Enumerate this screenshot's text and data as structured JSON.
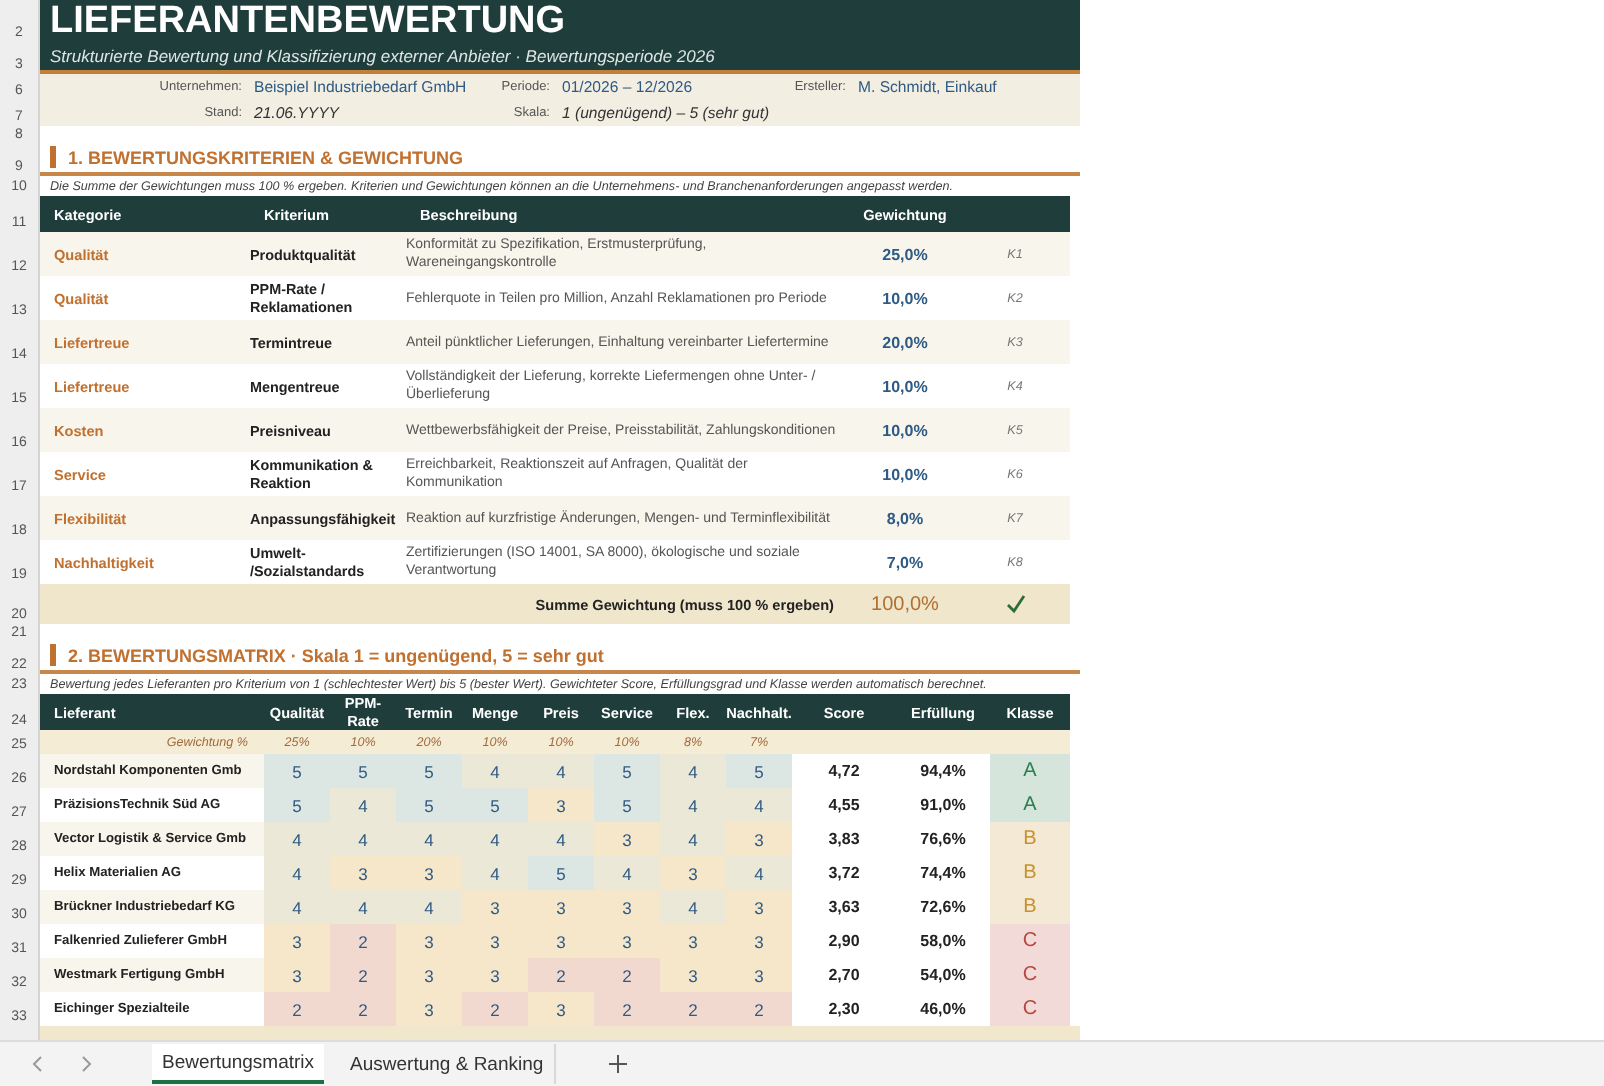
{
  "rows": [
    {
      "kind": "title",
      "row": "2",
      "text": "LIEFERANTENBEWERTUNG"
    },
    {
      "kind": "subtitle",
      "row": "3",
      "text": "Strukturierte Bewertung und Klassifizierung externer Anbieter  ·  Bewertungsperiode 2026"
    },
    {
      "kind": "info",
      "row": "6",
      "fields": [
        {
          "label": "Unternehmen:",
          "value": "Beispiel Industriebedarf GmbH"
        },
        {
          "label": "Periode:",
          "value": "01/2026 – 12/2026"
        },
        {
          "label": "Ersteller:",
          "value": "M. Schmidt, Einkauf"
        }
      ]
    },
    {
      "kind": "info",
      "row": "7",
      "fields": [
        {
          "label": "Stand:",
          "value": "21.06.YYYY"
        },
        {
          "label": "Skala:",
          "value": "1 (ungenügend) – 5 (sehr gut)"
        }
      ]
    },
    {
      "kind": "blank",
      "row": "8"
    },
    {
      "kind": "section",
      "row": "9",
      "text": "1. BEWERTUNGSKRITERIEN & GEWICHTUNG"
    },
    {
      "kind": "note",
      "row": "10",
      "text": "Die Summe der Gewichtungen muss 100 % ergeben. Kriterien und Gewichtungen können an die Unternehmens- und Branchenanforderungen angepasst werden."
    },
    {
      "kind": "criteria_header",
      "row": "11",
      "columns": [
        "Kategorie",
        "Kriterium",
        "Beschreibung",
        "Gewichtung"
      ]
    },
    {
      "kind": "criterion",
      "row": "12",
      "category": "Qualität",
      "criterion": "Produktqualität",
      "description": "Konformität zu Spezifikation, Erstmusterprüfung, Wareneingangskontrolle",
      "weight": "25,0%",
      "id": "K1"
    },
    {
      "kind": "criterion",
      "row": "13",
      "category": "Qualität",
      "criterion": "PPM-Rate / Reklamationen",
      "description": "Fehlerquote in Teilen pro Million, Anzahl Reklamationen pro Periode",
      "weight": "10,0%",
      "id": "K2"
    },
    {
      "kind": "criterion",
      "row": "14",
      "category": "Liefertreue",
      "criterion": "Termintreue",
      "description": "Anteil pünktlicher Lieferungen, Einhaltung vereinbarter Liefertermine",
      "weight": "20,0%",
      "id": "K3"
    },
    {
      "kind": "criterion",
      "row": "15",
      "category": "Liefertreue",
      "criterion": "Mengentreue",
      "description": "Vollständigkeit der Lieferung, korrekte Liefermengen ohne Unter- /Überlieferung",
      "weight": "10,0%",
      "id": "K4"
    },
    {
      "kind": "criterion",
      "row": "16",
      "category": "Kosten",
      "criterion": "Preisniveau",
      "description": "Wettbewerbsfähigkeit der Preise, Preisstabilität, Zahlungskonditionen",
      "weight": "10,0%",
      "id": "K5"
    },
    {
      "kind": "criterion",
      "row": "17",
      "category": "Service",
      "criterion": "Kommunikation & Reaktion",
      "description": "Erreichbarkeit, Reaktionszeit auf Anfragen, Qualität der Kommunikation",
      "weight": "10,0%",
      "id": "K6"
    },
    {
      "kind": "criterion",
      "row": "18",
      "category": "Flexibilität",
      "criterion": "Anpassungsfähigkeit",
      "description": "Reaktion auf kurzfristige Änderungen, Mengen- und Terminflexibilität",
      "weight": "8,0%",
      "id": "K7"
    },
    {
      "kind": "criterion",
      "row": "19",
      "category": "Nachhaltigkeit",
      "criterion": "Umwelt- /Sozialstandards",
      "description": "Zertifizierungen (ISO 14001, SA 8000), ökologische und soziale Verantwortung",
      "weight": "7,0%",
      "id": "K8"
    },
    {
      "kind": "sum",
      "row": "20",
      "label": "Summe Gewichtung (muss 100 % ergeben)",
      "total": "100,0%",
      "valid": true
    },
    {
      "kind": "blank",
      "row": "21"
    },
    {
      "kind": "section",
      "row": "22",
      "text": "2. BEWERTUNGSMATRIX  ·  Skala 1 = ungenügend, 5 = sehr gut"
    },
    {
      "kind": "note",
      "row": "23",
      "text": "Bewertung jedes Lieferanten pro Kriterium von 1 (schlechtester Wert) bis 5 (bester Wert). Gewichteter Score, Erfüllungsgrad und Klasse werden automatisch berechnet."
    },
    {
      "kind": "matrix_header",
      "row": "24",
      "columns": [
        "Lieferant",
        "Qualität",
        "PPM-Rate",
        "Termin",
        "Menge",
        "Preis",
        "Service",
        "Flex.",
        "Nachhalt.",
        "Score",
        "Erfüllung",
        "Klasse"
      ]
    },
    {
      "kind": "weights",
      "row": "25",
      "label": "Gewichtung %",
      "values": [
        "25%",
        "10%",
        "20%",
        "10%",
        "10%",
        "10%",
        "8%",
        "7%"
      ]
    },
    {
      "kind": "supplier",
      "row": "26",
      "name": "Nordstahl Komponenten Gmb",
      "scores": [
        {
          "value": "5",
          "color": "#dce7e3"
        },
        {
          "value": "5",
          "color": "#dce7e3"
        },
        {
          "value": "5",
          "color": "#dce7e3"
        },
        {
          "value": "4",
          "color": "#ebe8d8"
        },
        {
          "value": "4",
          "color": "#ebe8d8"
        },
        {
          "value": "5",
          "color": "#dce7e3"
        },
        {
          "value": "4",
          "color": "#ebe8d8"
        },
        {
          "value": "5",
          "color": "#dce7e3"
        }
      ],
      "score": "4,72",
      "fulfillment": "94,4%",
      "class": {
        "text": "A",
        "color": "#2e7d4f"
      }
    },
    {
      "kind": "supplier",
      "row": "27",
      "name": "PräzisionsTechnik Süd AG",
      "scores": [
        {
          "value": "5",
          "color": "#dce7e3"
        },
        {
          "value": "4",
          "color": "#ebe8d8"
        },
        {
          "value": "5",
          "color": "#dce7e3"
        },
        {
          "value": "5",
          "color": "#dce7e3"
        },
        {
          "value": "3",
          "color": "#f6e7cb"
        },
        {
          "value": "5",
          "color": "#dce7e3"
        },
        {
          "value": "4",
          "color": "#ebe8d8"
        },
        {
          "value": "4",
          "color": "#ebe8d8"
        }
      ],
      "score": "4,55",
      "fulfillment": "91,0%",
      "class": {
        "text": "A",
        "color": "#2e7d4f"
      }
    },
    {
      "kind": "supplier",
      "row": "28",
      "name": "Vector Logistik & Service Gmb",
      "scores": [
        {
          "value": "4",
          "color": "#ebe8d8"
        },
        {
          "value": "4",
          "color": "#ebe8d8"
        },
        {
          "value": "4",
          "color": "#ebe8d8"
        },
        {
          "value": "4",
          "color": "#ebe8d8"
        },
        {
          "value": "4",
          "color": "#ebe8d8"
        },
        {
          "value": "3",
          "color": "#f6e7cb"
        },
        {
          "value": "4",
          "color": "#ebe8d8"
        },
        {
          "value": "3",
          "color": "#f6e7cb"
        }
      ],
      "score": "3,83",
      "fulfillment": "76,6%",
      "class": {
        "text": "B",
        "color": "#c8902e"
      }
    },
    {
      "kind": "supplier",
      "row": "29",
      "name": "Helix Materialien AG",
      "scores": [
        {
          "value": "4",
          "color": "#ebe8d8"
        },
        {
          "value": "3",
          "color": "#f6e7cb"
        },
        {
          "value": "3",
          "color": "#f6e7cb"
        },
        {
          "value": "4",
          "color": "#ebe8d8"
        },
        {
          "value": "5",
          "color": "#dce7e3"
        },
        {
          "value": "4",
          "color": "#ebe8d8"
        },
        {
          "value": "3",
          "color": "#f6e7cb"
        },
        {
          "value": "4",
          "color": "#ebe8d8"
        }
      ],
      "score": "3,72",
      "fulfillment": "74,4%",
      "class": {
        "text": "B",
        "color": "#c8902e"
      }
    },
    {
      "kind": "supplier",
      "row": "30",
      "name": "Brückner Industriebedarf KG",
      "scores": [
        {
          "value": "4",
          "color": "#ebe8d8"
        },
        {
          "value": "4",
          "color": "#ebe8d8"
        },
        {
          "value": "4",
          "color": "#ebe8d8"
        },
        {
          "value": "3",
          "color": "#f6e7cb"
        },
        {
          "value": "3",
          "color": "#f6e7cb"
        },
        {
          "value": "3",
          "color": "#f6e7cb"
        },
        {
          "value": "4",
          "color": "#ebe8d8"
        },
        {
          "value": "3",
          "color": "#f6e7cb"
        }
      ],
      "score": "3,63",
      "fulfillment": "72,6%",
      "class": {
        "text": "B",
        "color": "#c8902e"
      }
    },
    {
      "kind": "supplier",
      "row": "31",
      "name": "Falkenried Zulieferer GmbH",
      "scores": [
        {
          "value": "3",
          "color": "#f6e7cb"
        },
        {
          "value": "2",
          "color": "#f2d9d0"
        },
        {
          "value": "3",
          "color": "#f6e7cb"
        },
        {
          "value": "3",
          "color": "#f6e7cb"
        },
        {
          "value": "3",
          "color": "#f6e7cb"
        },
        {
          "value": "3",
          "color": "#f6e7cb"
        },
        {
          "value": "3",
          "color": "#f6e7cb"
        },
        {
          "value": "3",
          "color": "#f6e7cb"
        }
      ],
      "score": "2,90",
      "fulfillment": "58,0%",
      "class": {
        "text": "C",
        "color": "#b8443c"
      }
    },
    {
      "kind": "supplier",
      "row": "32",
      "name": "Westmark Fertigung GmbH",
      "scores": [
        {
          "value": "3",
          "color": "#f6e7cb"
        },
        {
          "value": "2",
          "color": "#f2d9d0"
        },
        {
          "value": "3",
          "color": "#f6e7cb"
        },
        {
          "value": "3",
          "color": "#f6e7cb"
        },
        {
          "value": "2",
          "color": "#f2d9d0"
        },
        {
          "value": "2",
          "color": "#f2d9d0"
        },
        {
          "value": "3",
          "color": "#f6e7cb"
        },
        {
          "value": "3",
          "color": "#f6e7cb"
        }
      ],
      "score": "2,70",
      "fulfillment": "54,0%",
      "class": {
        "text": "C",
        "color": "#b8443c"
      }
    },
    {
      "kind": "supplier",
      "row": "33",
      "name": "Eichinger Spezialteile",
      "scores": [
        {
          "value": "2",
          "color": "#f2d9d0"
        },
        {
          "value": "2",
          "color": "#f2d9d0"
        },
        {
          "value": "3",
          "color": "#f6e7cb"
        },
        {
          "value": "2",
          "color": "#f2d9d0"
        },
        {
          "value": "3",
          "color": "#f6e7cb"
        },
        {
          "value": "2",
          "color": "#f2d9d0"
        },
        {
          "value": "2",
          "color": "#f2d9d0"
        },
        {
          "value": "2",
          "color": "#f2d9d0"
        }
      ],
      "score": "2,30",
      "fulfillment": "46,0%",
      "class": {
        "text": "C",
        "color": "#b8443c"
      }
    }
  ],
  "sheet_tabs": [
    {
      "label": "Bewertungsmatrix",
      "selected": true
    },
    {
      "label": "Auswertung & Ranking",
      "selected": false
    }
  ]
}
